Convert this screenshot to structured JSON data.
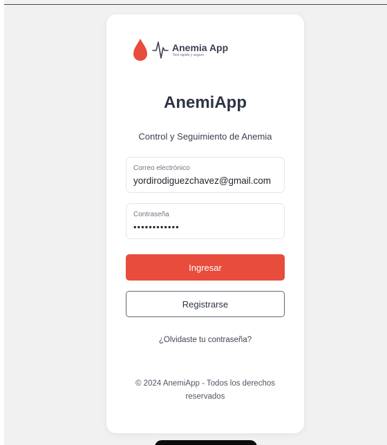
{
  "logo": {
    "name": "Anemia App",
    "tagline": "Test rápido y seguro",
    "colors": {
      "drop": "#e74c3c",
      "pulse": "#3b3f52"
    }
  },
  "title": "AnemiApp",
  "subtitle": "Control y Seguimiento de Anemia",
  "form": {
    "email": {
      "label": "Correo electrónico",
      "value": "yordirodiguezchavez@gmail.com"
    },
    "password": {
      "label": "Contraseña",
      "value": "••••••••••••"
    }
  },
  "buttons": {
    "login": "Ingresar",
    "register": "Registrarse"
  },
  "forgot_password": "¿Olvidaste tu contraseña?",
  "footer": "© 2024 AnemiApp - Todos los derechos reservados",
  "colors": {
    "primary": "#e74c3c",
    "background": "#f1f1f2",
    "card": "#ffffff"
  }
}
